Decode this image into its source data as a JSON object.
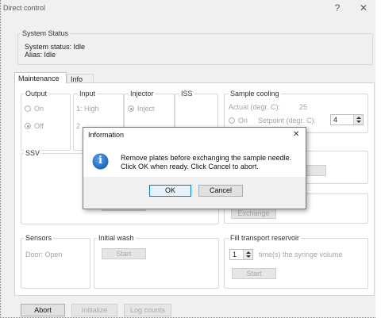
{
  "window": {
    "title": "Direct control",
    "help_symbol": "?",
    "close_symbol": "✕"
  },
  "system_status": {
    "group_title": "System Status",
    "status_line": "System status: Idle",
    "alias_line": "Alias: Idle"
  },
  "tabs": [
    {
      "label": "Maintenance",
      "active": true
    },
    {
      "label": "Info",
      "active": false
    }
  ],
  "output": {
    "title": "Output",
    "on_label": "On",
    "off_label": "Off"
  },
  "input": {
    "title": "Input",
    "high_label": "1: High",
    "second_label": "2"
  },
  "injector": {
    "title": "Injector",
    "inject_label": "Inject"
  },
  "iss": {
    "title": "ISS"
  },
  "sample_cooling": {
    "title": "Sample cooling",
    "actual_label": "Actual (degr. C):",
    "actual_value": "25",
    "on_label": "On",
    "setpoint_label": "Setpoint (degr. C):",
    "setpoint_value": "4"
  },
  "ssv": {
    "title": "SSV"
  },
  "exchange": {
    "button_label": "Exchange"
  },
  "sensors": {
    "title": "Sensors",
    "door_label": "Door: Open"
  },
  "initial_wash": {
    "title": "Initial wash",
    "start_label": "Start"
  },
  "fill_reservoir": {
    "title": "Fill transport reservoir",
    "times_value": "1",
    "times_label": "time(s) the syringe volume",
    "start_label": "Start"
  },
  "footer": {
    "abort_label": "Abort",
    "initialize_label": "Initialize",
    "log_counts_label": "Log counts"
  },
  "dialog": {
    "title": "Information",
    "close_symbol": "✕",
    "message_line1": "Remove plates before exchanging the sample needle.",
    "message_line2": "Click OK when ready. Click Cancel to abort.",
    "ok_label": "OK",
    "cancel_label": "Cancel",
    "info_icon_glyph": "i",
    "info_icon_color": "#1e6fc5"
  },
  "icons": {
    "up": "arrow-up-icon",
    "down": "arrow-down-icon",
    "info": "information-icon"
  }
}
